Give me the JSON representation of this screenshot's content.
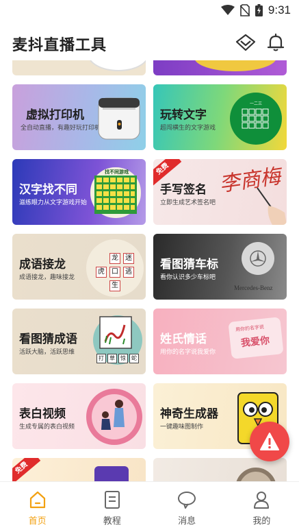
{
  "status": {
    "time": "9:31"
  },
  "header": {
    "title": "麦抖直播工具"
  },
  "cards": [
    {
      "title": "虚拟打印机",
      "sub": "全自动直播，有趣好玩打印机"
    },
    {
      "title": "玩转文字",
      "sub": "超闯横生的文字游戏",
      "grid_title": "一二三"
    },
    {
      "title": "汉字找不同",
      "sub": "滋练眼力从文字游戏开始",
      "grid_title": "找不同游戏",
      "grid_char": "肾"
    },
    {
      "title": "手写签名",
      "sub": "立即生成艺术签名吧",
      "badge": "免费",
      "signature": "李商梅"
    },
    {
      "title": "成语接龙",
      "sub": "成语接龙，趣味接龙",
      "tiles": [
        "龙",
        "迷",
        "虎",
        "口",
        "逃",
        "生"
      ]
    },
    {
      "title": "看图猜车标",
      "sub": "看你认识多少车标吧",
      "brand": "Mercedes-Benz"
    },
    {
      "title": "看图猜成语",
      "sub": "活跃大脑，活跃思维",
      "tiles": [
        "打",
        "草",
        "惊",
        "蛇"
      ]
    },
    {
      "title": "姓氏情话",
      "sub": "用你的名字说我爱你",
      "bubble_small": "用你的名字说",
      "bubble_big": "我爱你"
    },
    {
      "title": "表白视频",
      "sub": "生成专属的表白视频"
    },
    {
      "title": "神奇生成器",
      "sub": "一键趣味图制作"
    },
    {
      "title": "",
      "sub": "",
      "badge": "免费"
    },
    {
      "title": "",
      "sub": ""
    }
  ],
  "nav": [
    {
      "label": "首页",
      "icon": "home-icon",
      "active": true
    },
    {
      "label": "教程",
      "icon": "document-icon",
      "active": false
    },
    {
      "label": "消息",
      "icon": "chat-bubble-icon",
      "active": false
    },
    {
      "label": "我的",
      "icon": "person-icon",
      "active": false
    }
  ],
  "colors": {
    "accent": "#f2a010",
    "fab": "#f04848",
    "badge": "#e02c2c"
  }
}
